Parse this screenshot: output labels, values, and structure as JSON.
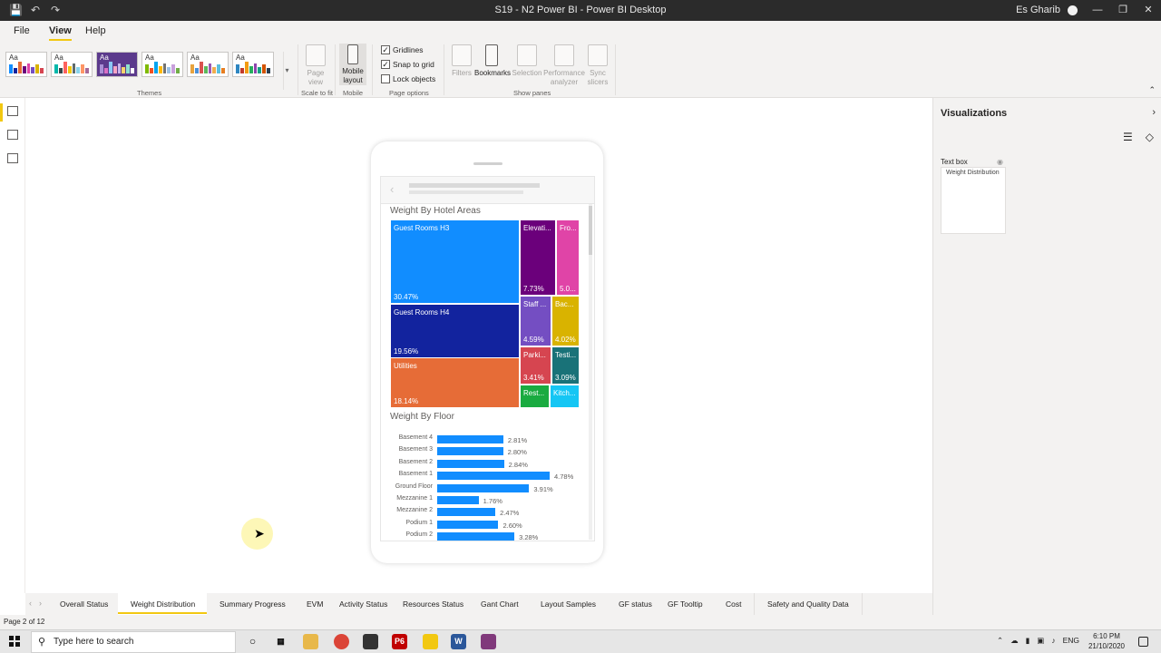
{
  "window": {
    "title": "S19 - N2 Power BI - Power BI Desktop",
    "user": "Es Gharib"
  },
  "menu": {
    "file": "File",
    "view": "View",
    "help": "Help"
  },
  "ribbon": {
    "themes_label": "Themes",
    "scale_label": "Scale to fit",
    "mobile_group_label": "Mobile",
    "page_options_label": "Page options",
    "show_panes_label": "Show panes",
    "page_view": "Page view",
    "mobile_layout": "Mobile layout",
    "gridlines": "Gridlines",
    "snap_to_grid": "Snap to grid",
    "lock_objects": "Lock objects",
    "filters": "Filters",
    "bookmarks": "Bookmarks",
    "selection": "Selection",
    "performance": "Performance analyzer",
    "sync": "Sync slicers",
    "gridlines_checked": true,
    "snap_checked": true,
    "lock_checked": false
  },
  "visualizations": {
    "header": "Visualizations",
    "text_box_label": "Text box",
    "text_box_value": "Weight Distribution"
  },
  "treemap": {
    "title": "Weight By Hotel Areas",
    "tiles": [
      {
        "label": "Guest Rooms H3",
        "pct": "30.47%",
        "color": "#118dff"
      },
      {
        "label": "Guest Rooms H4",
        "pct": "19.56%",
        "color": "#12239e"
      },
      {
        "label": "Utilities",
        "pct": "18.14%",
        "color": "#e66c37"
      },
      {
        "label": "Elevati...",
        "pct": "7.73%",
        "color": "#6b007b"
      },
      {
        "label": "Fro...",
        "pct": "5.0...",
        "color": "#e044a7"
      },
      {
        "label": "Staff ...",
        "pct": "4.59%",
        "color": "#744ec2"
      },
      {
        "label": "Bac...",
        "pct": "4.02%",
        "color": "#d9b300"
      },
      {
        "label": "Parki...",
        "pct": "3.41%",
        "color": "#d64550"
      },
      {
        "label": "Testi...",
        "pct": "3.09%",
        "color": "#197278"
      },
      {
        "label": "Rest...",
        "pct": "",
        "color": "#1aab40"
      },
      {
        "label": "Kitch...",
        "pct": "",
        "color": "#15c6f4"
      }
    ]
  },
  "chart_data": {
    "type": "bar",
    "title": "Weight By Floor",
    "categories": [
      "Basement 4",
      "Basement 3",
      "Basement 2",
      "Basement 1",
      "Ground Floor",
      "Mezzanine 1",
      "Mezzanine 2",
      "Podium 1",
      "Podium 2"
    ],
    "values": [
      2.81,
      2.8,
      2.84,
      4.78,
      3.91,
      1.76,
      2.47,
      2.6,
      3.28
    ],
    "labels": [
      "2.81%",
      "2.80%",
      "2.84%",
      "4.78%",
      "3.91%",
      "1.76%",
      "2.47%",
      "2.60%",
      "3.28%"
    ],
    "color": "#118dff"
  },
  "tabs": [
    "Overall Status",
    "Weight Distribution",
    "Summary Progress",
    "EVM",
    "Activity Status",
    "Resources Status",
    "Gant Chart",
    "Layout Samples",
    "GF status",
    "GF Tooltip",
    "Cost",
    "Safety and Quality Data"
  ],
  "active_tab": "Weight Distribution",
  "status": {
    "page": "Page 2 of 12"
  },
  "taskbar": {
    "search_placeholder": "Type here to search",
    "lang": "ENG",
    "time": "6:10 PM",
    "date": "21/10/2020"
  }
}
